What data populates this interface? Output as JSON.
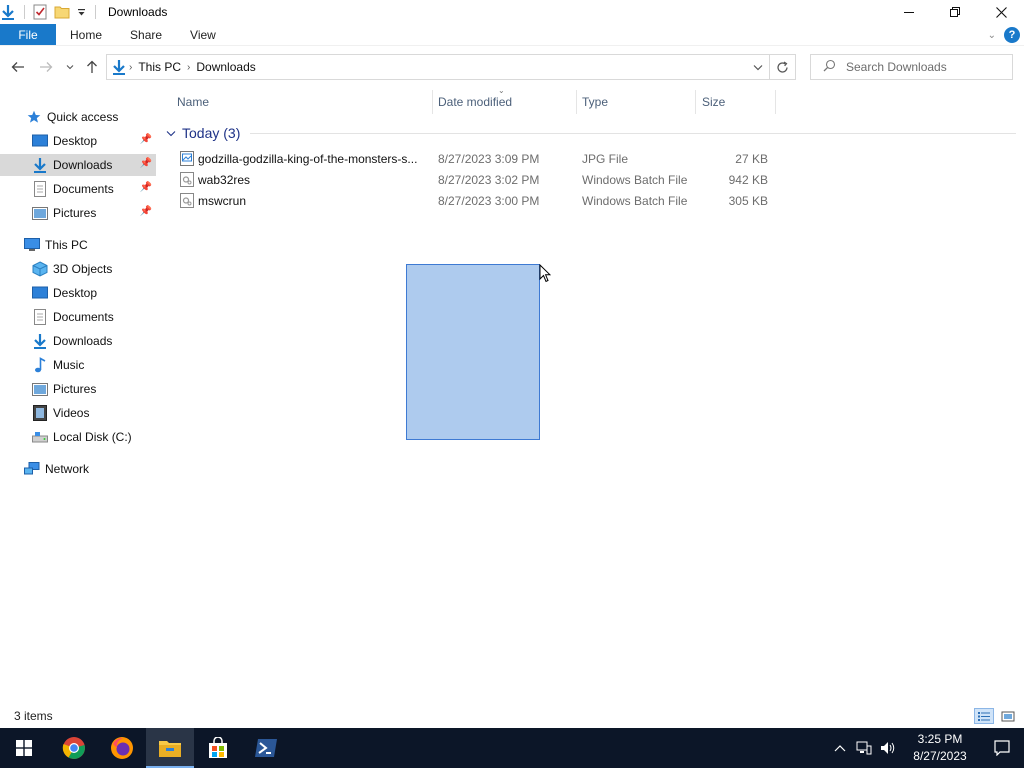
{
  "window": {
    "title": "Downloads",
    "controls": [
      "minimize",
      "restore",
      "close"
    ]
  },
  "ribbon": {
    "tabs": [
      {
        "label": "File"
      },
      {
        "label": "Home"
      },
      {
        "label": "Share"
      },
      {
        "label": "View"
      }
    ]
  },
  "navigation": {
    "breadcrumbs": [
      "This PC",
      "Downloads"
    ],
    "search_placeholder": "Search Downloads"
  },
  "sidebar": {
    "items": [
      {
        "label": "Quick access",
        "icon": "star-icon",
        "pinned": false,
        "selected": false
      },
      {
        "label": "Desktop",
        "icon": "desktop-icon",
        "pinned": true,
        "selected": false
      },
      {
        "label": "Downloads",
        "icon": "download-icon",
        "pinned": true,
        "selected": true
      },
      {
        "label": "Documents",
        "icon": "documents-icon",
        "pinned": true,
        "selected": false
      },
      {
        "label": "Pictures",
        "icon": "pictures-icon",
        "pinned": true,
        "selected": false
      },
      {
        "label": "This PC",
        "icon": "computer-icon",
        "pinned": false,
        "selected": false
      },
      {
        "label": "3D Objects",
        "icon": "cube-icon",
        "pinned": false,
        "selected": false
      },
      {
        "label": "Desktop",
        "icon": "desktop-icon",
        "pinned": false,
        "selected": false
      },
      {
        "label": "Documents",
        "icon": "documents-icon",
        "pinned": false,
        "selected": false
      },
      {
        "label": "Downloads",
        "icon": "download-icon",
        "pinned": false,
        "selected": false
      },
      {
        "label": "Music",
        "icon": "music-icon",
        "pinned": false,
        "selected": false
      },
      {
        "label": "Pictures",
        "icon": "pictures-icon",
        "pinned": false,
        "selected": false
      },
      {
        "label": "Videos",
        "icon": "videos-icon",
        "pinned": false,
        "selected": false
      },
      {
        "label": "Local Disk (C:)",
        "icon": "drive-icon",
        "pinned": false,
        "selected": false
      },
      {
        "label": "Network",
        "icon": "network-icon",
        "pinned": false,
        "selected": false
      }
    ]
  },
  "file_list": {
    "columns": [
      "Name",
      "Date modified",
      "Type",
      "Size"
    ],
    "group_label": "Today (3)",
    "files": [
      {
        "name": "godzilla-godzilla-king-of-the-monsters-s...",
        "date": "8/27/2023 3:09 PM",
        "type": "JPG File",
        "size": "27 KB",
        "icon": "image-file-icon"
      },
      {
        "name": "wab32res",
        "date": "8/27/2023 3:02 PM",
        "type": "Windows Batch File",
        "size": "942 KB",
        "icon": "batch-file-icon"
      },
      {
        "name": "mswcrun",
        "date": "8/27/2023 3:00 PM",
        "type": "Windows Batch File",
        "size": "305 KB",
        "icon": "batch-file-icon"
      }
    ]
  },
  "status": {
    "item_count": "3 items"
  },
  "taskbar": {
    "apps": [
      "start-icon",
      "chrome-icon",
      "firefox-icon",
      "file-explorer-icon",
      "store-icon",
      "powershell-icon"
    ],
    "time": "3:25 PM",
    "date": "8/27/2023"
  },
  "colors": {
    "accent": "#1979ca",
    "selection_fill": "#aecbee",
    "selection_border": "#3e7ad3",
    "taskbar": "#0c1628",
    "group_header": "#1e3287"
  }
}
